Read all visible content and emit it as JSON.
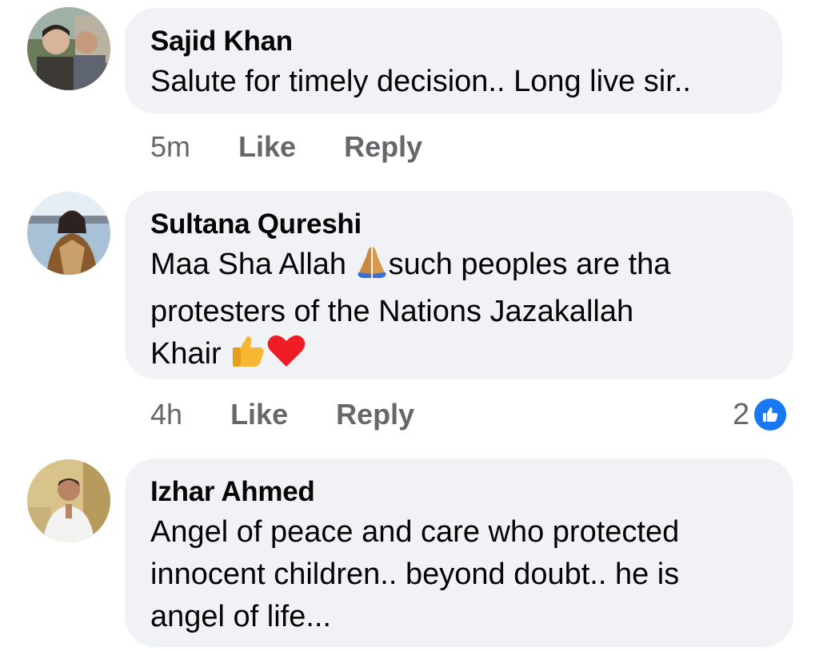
{
  "comments": [
    {
      "author": "Sajid Khan",
      "text_lines": [
        "Salute for timely decision.. Long live sir.."
      ],
      "time": "5m",
      "like_label": "Like",
      "reply_label": "Reply"
    },
    {
      "author": "Sultana Qureshi",
      "text_line1_a": "Maa Sha Allah ",
      "text_line1_b": "such peoples are tha",
      "text_line2": "protesters  of the Nations Jazakallah",
      "text_line3": "Khair ",
      "emojis": [
        "folded-hands",
        "thumbs-up",
        "red-heart"
      ],
      "time": "4h",
      "like_label": "Like",
      "reply_label": "Reply",
      "reaction_count": "2",
      "reaction_icon": "like-icon"
    },
    {
      "author": "Izhar Ahmed",
      "text_lines": [
        "Angel of peace and care who protected",
        "innocent children.. beyond doubt.. he is",
        "angel of life..."
      ]
    }
  ],
  "colors": {
    "bubble": "#f0f2f5",
    "meta": "#65676b",
    "text": "#050505",
    "like_blue": "#1877f2"
  }
}
